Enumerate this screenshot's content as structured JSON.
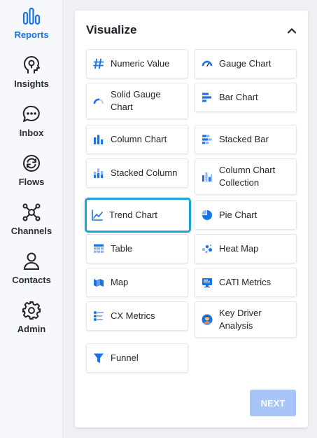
{
  "sidebar": {
    "items": [
      {
        "label": "Reports",
        "icon": "bar-chart-icon",
        "active": true
      },
      {
        "label": "Insights",
        "icon": "head-lightbulb-icon"
      },
      {
        "label": "Inbox",
        "icon": "chat-bubble-icon"
      },
      {
        "label": "Flows",
        "icon": "refresh-cycle-icon"
      },
      {
        "label": "Channels",
        "icon": "network-hub-icon"
      },
      {
        "label": "Contacts",
        "icon": "person-icon"
      },
      {
        "label": "Admin",
        "icon": "gear-icon"
      }
    ]
  },
  "panel": {
    "title": "Visualize",
    "collapse_icon": "chevron-up-icon",
    "tiles": [
      {
        "label": "Numeric Value",
        "icon": "numeric-value-icon"
      },
      {
        "label": "Gauge Chart",
        "icon": "gauge-icon"
      },
      {
        "label": "Solid Gauge Chart",
        "icon": "solid-gauge-icon"
      },
      {
        "label": "Bar Chart",
        "icon": "bar-chart-icon"
      },
      {
        "label": "Column Chart",
        "icon": "column-chart-icon"
      },
      {
        "label": "Stacked Bar",
        "icon": "stacked-bar-icon"
      },
      {
        "label": "Stacked Column",
        "icon": "stacked-column-icon"
      },
      {
        "label": "Column Chart Collection",
        "icon": "column-collection-icon"
      },
      {
        "label": "Trend Chart",
        "icon": "trend-chart-icon",
        "selected": true
      },
      {
        "label": "Pie Chart",
        "icon": "pie-chart-icon"
      },
      {
        "label": "Table",
        "icon": "table-icon"
      },
      {
        "label": "Heat Map",
        "icon": "heat-map-icon"
      },
      {
        "label": "Map",
        "icon": "map-icon"
      },
      {
        "label": "CATI Metrics",
        "icon": "cati-metrics-icon"
      },
      {
        "label": "CX Metrics",
        "icon": "cx-metrics-icon"
      },
      {
        "label": "Key Driver Analysis",
        "icon": "key-driver-avatar-icon"
      },
      {
        "label": "Funnel",
        "icon": "funnel-icon"
      }
    ],
    "next_label": "NEXT"
  },
  "colors": {
    "accent": "#1a73e8",
    "selected_border": "#1aa6d8",
    "next_disabled": "#a9c4f6"
  }
}
